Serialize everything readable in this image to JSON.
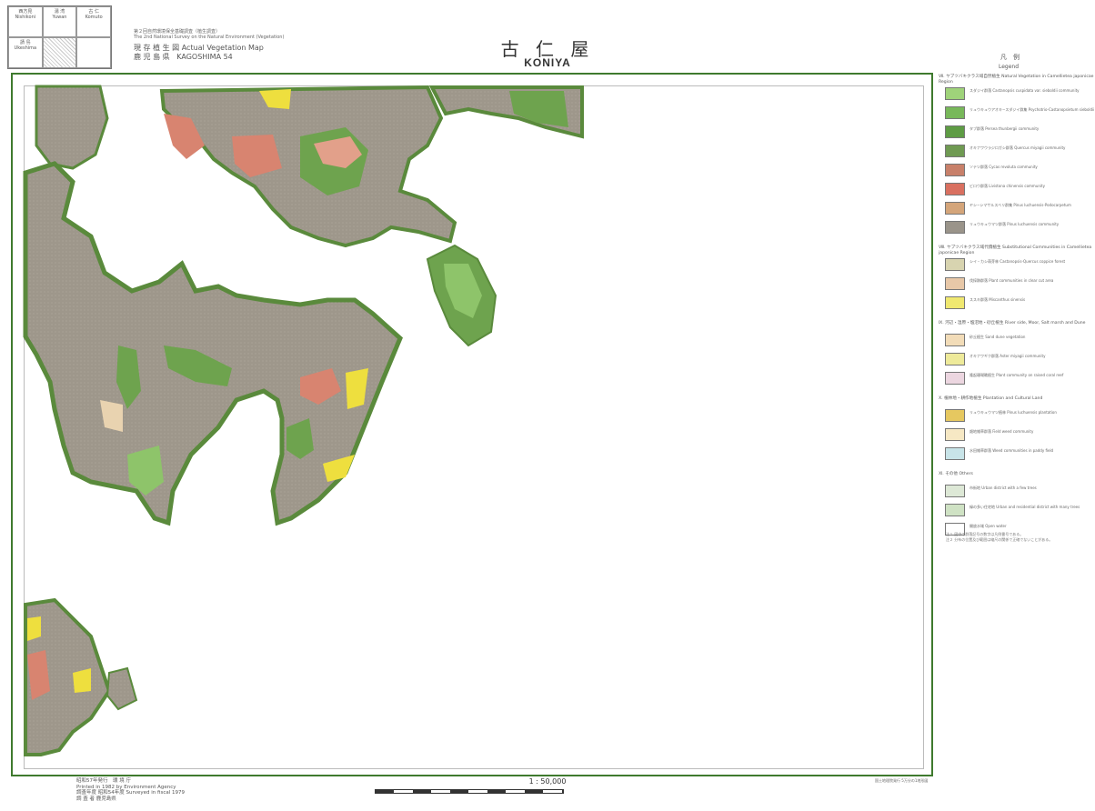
{
  "index_sheets": [
    {
      "jp": "西方見",
      "en": "Nishikoni",
      "hatch": false
    },
    {
      "jp": "湯 湾",
      "en": "Yuwan",
      "hatch": false
    },
    {
      "jp": "古 仁",
      "en": "Komuto",
      "hatch": false
    },
    {
      "jp": "請 島",
      "en": "Ukeshima",
      "hatch": false
    },
    {
      "jp": "",
      "en": "",
      "hatch": true
    },
    {
      "jp": "",
      "en": "",
      "hatch": false
    }
  ],
  "header": {
    "survey_jp": "第２回自然環境保全基礎調査（植生調査）",
    "survey_en": "The 2nd National Survey on the Natural Environment (Vegetation)",
    "map_type_jp": "現 存 植 生 図",
    "map_type_en": "Actual Vegetation Map",
    "prefecture_jp": "鹿 児 島 県",
    "sheet": "KAGOSHIMA 54",
    "title_jp": "古 仁 屋",
    "title_roman": "KONIYA",
    "legend_jp": "凡　例",
    "legend_en": "Legend"
  },
  "legend": {
    "sections": [
      {
        "label": "Ⅶ. ヤブツバキクラス域自然植生  Natural Vegetation in Camellietea japonicae Region",
        "items": [
          {
            "code": "",
            "color": "#9fd37a",
            "text": "スダジイ群落  Castanopsis cuspidata var. sieboldii community"
          },
          {
            "code": "",
            "color": "#78b85a",
            "text": "リュウキュウアオキ−スダジイ群集  Psychotrio-Castanopsietum sieboldii"
          },
          {
            "code": "",
            "color": "#5e9c44",
            "text": "タブ群落  Persea thunbergii community"
          },
          {
            "code": "",
            "color": "#6f9a52",
            "text": "オキナワウラジロガシ群落  Quercus miyagii community"
          },
          {
            "code": "",
            "color": "#c8806a",
            "text": "ソテツ群落  Cycas revoluta community"
          },
          {
            "code": "",
            "color": "#d97060",
            "text": "ビロウ群落  Livistona chinensis community"
          },
          {
            "code": "",
            "color": "#d4a57a",
            "text": "ヤシ−シマサルスベリ群集  Pinus luchuensis-Podocarpetum"
          },
          {
            "code": "",
            "color": "#9a948a",
            "text": "リュウキュウマツ群落  Pinus luchuensis community"
          }
        ]
      },
      {
        "label": "Ⅷ. ヤブツバキクラス域代償植生  Substitutional Communities in Camellietea japonicae Region",
        "items": [
          {
            "code": "",
            "color": "#d8d4b0",
            "text": "シイ・カシ萌芽林  Castanopsis-Quercus coppice forest"
          },
          {
            "code": "",
            "color": "#e8c8a8",
            "text": "伐採跡群落  Plant communities in clear cut area"
          },
          {
            "code": "",
            "color": "#f0e870",
            "text": "ススキ群落  Miscanthus sinensis"
          }
        ]
      },
      {
        "label": "Ⅸ. 河辺・湿原・塩沼地・砂丘植生  River side, Moor, Salt marsh and Dune",
        "items": [
          {
            "code": "",
            "color": "#f2dcb8",
            "text": "砂丘植生  Sand dune vegetation"
          },
          {
            "code": "",
            "color": "#eeea9a",
            "text": "オキナワギク群落  Aster miyagii community"
          },
          {
            "code": "",
            "color": "#ecd6e0",
            "text": "隆起珊瑚礁植生  Plant community on raised coral reef"
          }
        ]
      },
      {
        "label": "Ⅹ. 植林地・耕作地植生  Plantation and Cultural Land",
        "items": [
          {
            "code": "",
            "color": "#e6c860",
            "text": "リュウキュウマツ植林  Pinus luchuensis plantation"
          },
          {
            "code": "",
            "color": "#f6e8c4",
            "text": "畑地雑草群落  Field weed community"
          },
          {
            "code": "",
            "color": "#c8e4e8",
            "text": "水田雑草群落  Weed communities in paddy field"
          }
        ]
      },
      {
        "label": "Ⅺ. その他  Others",
        "items": [
          {
            "code": "",
            "color": "#dde8d6",
            "text": "市街地  Urban district with a few trees"
          },
          {
            "code": "",
            "color": "#cfe2c4",
            "text": "緑の多い住宅地  Urban and residential district with many trees"
          },
          {
            "code": "",
            "color": "#ffffff",
            "text": "開放水域  Open water"
          }
        ]
      }
    ],
    "notes": [
      "注１ 図中の群落記号の数字は凡例番号である。",
      "注２ 分布の位置及び範囲は縮尺の関係で正確でないことがある。"
    ]
  },
  "footer": {
    "published": "昭和57年発行　環 境 庁",
    "printed": "Printed in 1982 by Environment Agency",
    "surveyed": "調査年度 昭和54年度 Surveyed in fiscal 1979",
    "author": "調 査 者 鹿児島県",
    "scale": "1 : 50,000",
    "right_note": "国土地理院発行 5万分の1地形図"
  },
  "colors": {
    "frame": "#3f7a2e",
    "pinus": "#9e978b",
    "forest": "#6ea34e",
    "forest_light": "#8ec46a",
    "salmon": "#d88470",
    "yellow": "#eedf3e",
    "beige": "#e9d3b0"
  }
}
